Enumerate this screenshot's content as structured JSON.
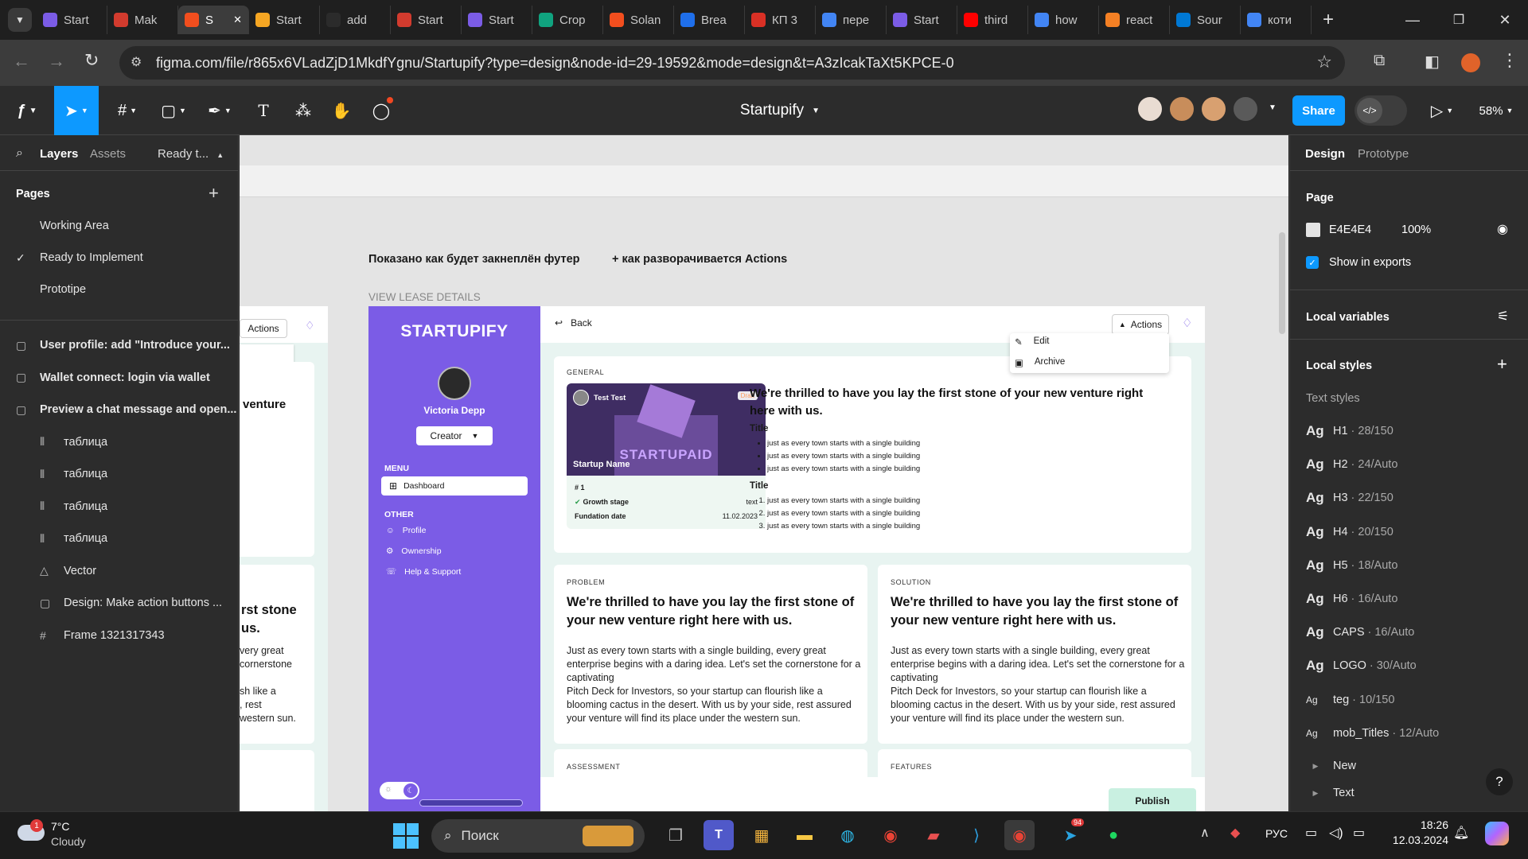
{
  "browser": {
    "tabs": [
      {
        "label": "Start",
        "color": "#7b5ce6",
        "icon": "startupify-icon"
      },
      {
        "label": "Mak",
        "color": "#d23b2e",
        "icon": "make-icon"
      },
      {
        "label": "S",
        "color": "#f24e1e",
        "icon": "figma-icon",
        "active": true
      },
      {
        "label": "Start",
        "color": "#f5a623",
        "icon": "firebase-icon"
      },
      {
        "label": "add",
        "color": "#2b2b2b",
        "icon": "github-icon"
      },
      {
        "label": "Start",
        "color": "#d23b2e",
        "icon": "make-icon"
      },
      {
        "label": "Start",
        "color": "#7b5ce6",
        "icon": "startupify-icon"
      },
      {
        "label": "Crop",
        "color": "#10a37f",
        "icon": "openai-icon"
      },
      {
        "label": "Solan",
        "color": "#f24e1e",
        "icon": "figma-icon"
      },
      {
        "label": "Brea",
        "color": "#1f6feb",
        "icon": "breadcrumbs-icon"
      },
      {
        "label": "КП 3",
        "color": "#d93025",
        "icon": "gmail-icon"
      },
      {
        "label": "пере",
        "color": "#4285f4",
        "icon": "google-icon"
      },
      {
        "label": "Start",
        "color": "#7b5ce6",
        "icon": "startupify-icon"
      },
      {
        "label": "third",
        "color": "#ff0000",
        "icon": "youtube-icon"
      },
      {
        "label": "how",
        "color": "#4285f4",
        "icon": "google-icon"
      },
      {
        "label": "react",
        "color": "#f48024",
        "icon": "stackoverflow-icon"
      },
      {
        "label": "Sour",
        "color": "#0078d4",
        "icon": "vscode-icon"
      },
      {
        "label": "коти",
        "color": "#4285f4",
        "icon": "google-icon"
      }
    ],
    "url": "figma.com/file/r865x6VLadZjD1MkdfYgnu/Startupify?type=design&node-id=29-19592&mode=design&t=A3zIcakTaXt5KPCE-0"
  },
  "figma": {
    "file_title": "Startupify",
    "share_label": "Share",
    "zoom": "58%",
    "left_tabs": {
      "layers": "Layers",
      "assets": "Assets",
      "page_switch": "Ready t..."
    },
    "pages_heading": "Pages",
    "pages": [
      "Working Area",
      "Ready to Implement",
      "Prototipe"
    ],
    "layers": [
      {
        "label": "User profile: add \"Introduce your...",
        "icon": "section-icon",
        "indent": 0
      },
      {
        "label": "Wallet connect: login via wallet",
        "icon": "section-icon",
        "indent": 0
      },
      {
        "label": "Preview a chat message and open...",
        "icon": "section-icon",
        "indent": 0
      },
      {
        "label": "таблица",
        "icon": "component-icon",
        "indent": 1
      },
      {
        "label": "таблица",
        "icon": "component-icon",
        "indent": 1
      },
      {
        "label": "таблица",
        "icon": "component-icon",
        "indent": 1
      },
      {
        "label": "таблица",
        "icon": "component-icon",
        "indent": 1
      },
      {
        "label": "Vector",
        "icon": "vector-icon",
        "indent": 1
      },
      {
        "label": "Design: Make action buttons ...",
        "icon": "section-icon",
        "indent": 1
      },
      {
        "label": "Frame 1321317343",
        "icon": "frame-icon",
        "indent": 1
      }
    ],
    "right": {
      "tabs": {
        "design": "Design",
        "prototype": "Prototype"
      },
      "page_heading": "Page",
      "page_color": "E4E4E4",
      "page_opacity": "100%",
      "show_exports": "Show in exports",
      "local_variables": "Local variables",
      "local_styles": "Local styles",
      "text_styles_heading": "Text styles",
      "text_styles": [
        {
          "ag": "Ag",
          "name": "H1",
          "spec": "· 28/150"
        },
        {
          "ag": "Ag",
          "name": "H2",
          "spec": "· 24/Auto"
        },
        {
          "ag": "Ag",
          "name": "H3",
          "spec": "· 22/150"
        },
        {
          "ag": "Ag",
          "name": "H4",
          "spec": "· 20/150"
        },
        {
          "ag": "Ag",
          "name": "H5",
          "spec": "· 18/Auto"
        },
        {
          "ag": "Ag",
          "name": "H6",
          "spec": "· 16/Auto"
        },
        {
          "ag": "Ag",
          "name": "CAPS",
          "spec": "· 16/Auto"
        },
        {
          "ag": "Ag",
          "name": "LOGO",
          "spec": "· 30/Auto"
        },
        {
          "ag": "Ag",
          "name": "teg",
          "spec": "· 10/150"
        },
        {
          "ag": "Ag",
          "name": "mob_Titles",
          "spec": "· 12/Auto"
        }
      ],
      "groups": [
        "New",
        "Text"
      ]
    }
  },
  "canvas": {
    "note_left": "Показано как будет закнеплён футер",
    "note_right": "+ как разворачивается Actions",
    "frame_label": "VIEW LEASE DETAILS",
    "actions_label": "Actions",
    "partial_text": {
      "venture": "venture",
      "stone": "rst stone",
      "us": "us.",
      "l1": "very great",
      "l2": "cornerstone",
      "l3": "sh like a",
      "l4": ", rest",
      "l5": "western sun."
    },
    "app": {
      "brand": "STARTUPIFY",
      "user_name": "Victoria Depp",
      "role": "Creator",
      "menu_heading": "MENU",
      "menu_item": "Dashboard",
      "other_heading": "OTHER",
      "other_items": [
        "Profile",
        "Ownership",
        "Help & Support"
      ],
      "back": "Back",
      "actions": "Actions",
      "dropdown": [
        "Edit",
        "Archive"
      ],
      "general_label": "GENERAL",
      "thumb_user": "Test Test",
      "thumb_badge": "Draft",
      "thumb_overlay": "Startup Name",
      "thumb_logo": "STARTUPAID",
      "stats": {
        "rank": "# 1",
        "row1_label": "Growth stage",
        "row1_value": "text",
        "row2_label": "Fundation date",
        "row2_value": "11.02.2023"
      },
      "general_heading": "We're thrilled to have you lay the first stone of your new venture right here with us.",
      "title1": "Title",
      "bullets": [
        "just as every town starts with a single building",
        "just as every town starts with a single building",
        "just as every town starts with a single building"
      ],
      "title2": "Title",
      "numbered": [
        "just as every town starts with a single building",
        "just as every town starts with a single building",
        "just as every town starts with a single building"
      ],
      "problem_label": "PROBLEM",
      "solution_label": "SOLUTION",
      "card_heading": "We're thrilled to have you lay the first stone of your new venture right here with us.",
      "card_p1": "Just as every town starts with a single building, every great enterprise begins with a daring idea. Let's set the cornerstone for a captivating",
      "card_p2": "Pitch Deck for Investors, so your startup can flourish like a blooming cactus in the desert. With us by your side, rest assured your venture will find its place under the western sun.",
      "assessment_label": "ASSESSMENT",
      "features_label": "FEATURES",
      "publish": "Publish"
    }
  },
  "taskbar": {
    "weather_temp": "7°C",
    "weather_desc": "Cloudy",
    "weather_badge": "1",
    "search": "Поиск",
    "lang": "РУС",
    "time": "18:26",
    "date": "12.03.2024",
    "telegram_badge": "94"
  }
}
